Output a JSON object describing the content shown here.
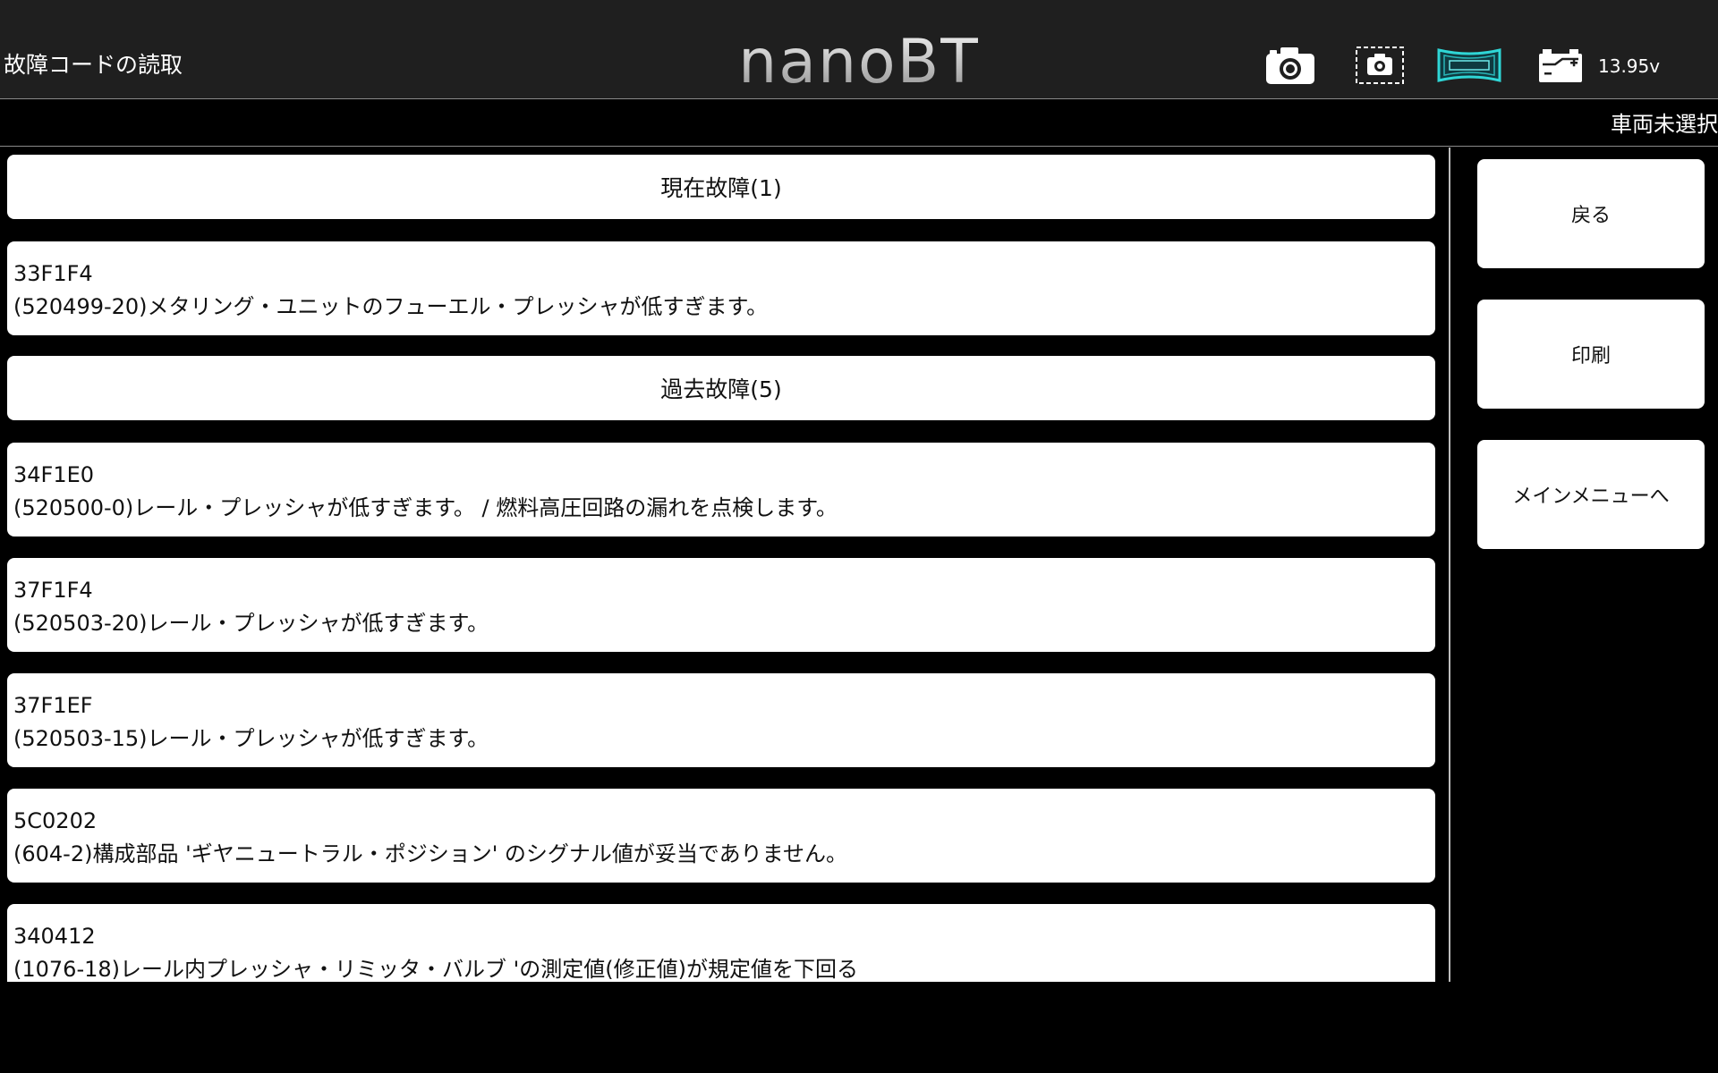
{
  "header": {
    "screen_title": "故障コードの読取",
    "brand": "nanoBT",
    "icons": [
      "camera-icon",
      "screenshot-frame-icon",
      "vci-connection-icon",
      "battery-icon"
    ],
    "voltage": "13.95v",
    "accent_color": "#2fd6d6"
  },
  "vehicle_status": "車両未選択",
  "faults": {
    "current_header": "現在故障(1)",
    "current": [
      {
        "code": "33F1F4",
        "description": "(520499-20)メタリング・ユニットのフューエル・プレッシャが低すぎます。"
      }
    ],
    "past_header": "過去故障(5)",
    "past": [
      {
        "code": "34F1E0",
        "description": "(520500-0)レール・プレッシャが低すぎます。 / 燃料高圧回路の漏れを点検します。"
      },
      {
        "code": "37F1F4",
        "description": "(520503-20)レール・プレッシャが低すぎます。"
      },
      {
        "code": "37F1EF",
        "description": "(520503-15)レール・プレッシャが低すぎます。"
      },
      {
        "code": "5C0202",
        "description": "(604-2)構成部品 'ギヤニュートラル・ポジション' のシグナル値が妥当でありません。"
      },
      {
        "code": "340412",
        "description": "(1076-18)レール内プレッシャ・リミッタ・バルブ 'の測定値(修正値)が規定値を下回る"
      }
    ]
  },
  "side_buttons": {
    "back": "戻る",
    "print": "印刷",
    "main_menu": "メインメニューへ"
  }
}
